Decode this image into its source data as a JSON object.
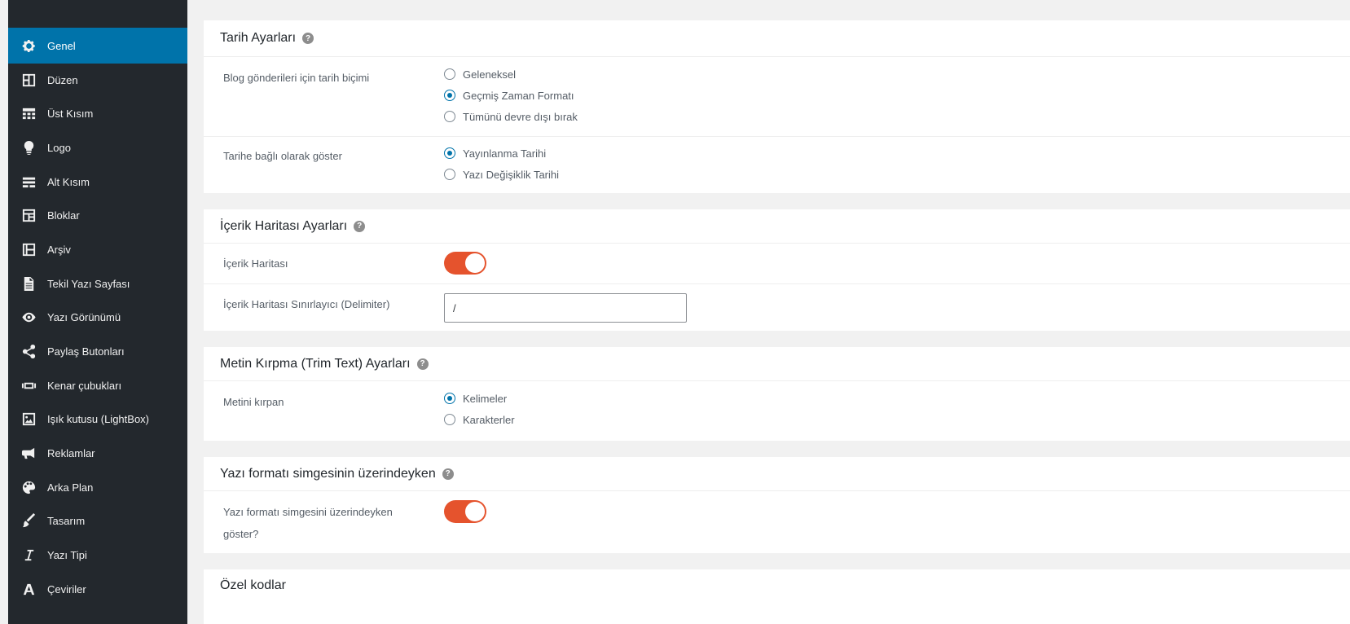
{
  "sidebar": {
    "items": [
      {
        "label": "Genel",
        "icon": "gear-icon",
        "active": true
      },
      {
        "label": "Düzen",
        "icon": "layout-icon"
      },
      {
        "label": "Üst Kısım",
        "icon": "header-grid-icon"
      },
      {
        "label": "Logo",
        "icon": "lightbulb-icon"
      },
      {
        "label": "Alt Kısım",
        "icon": "footer-icon"
      },
      {
        "label": "Bloklar",
        "icon": "blocks-icon"
      },
      {
        "label": "Arşiv",
        "icon": "archive-icon"
      },
      {
        "label": "Tekil Yazı Sayfası",
        "icon": "document-icon"
      },
      {
        "label": "Yazı Görünümü",
        "icon": "eye-icon"
      },
      {
        "label": "Paylaş Butonları",
        "icon": "share-icon"
      },
      {
        "label": "Kenar çubukları",
        "icon": "sidebar-icon"
      },
      {
        "label": "Işık kutusu (LightBox)",
        "icon": "image-icon"
      },
      {
        "label": "Reklamlar",
        "icon": "megaphone-icon"
      },
      {
        "label": "Arka Plan",
        "icon": "palette-icon"
      },
      {
        "label": "Tasarım",
        "icon": "brush-icon"
      },
      {
        "label": "Yazı Tipi",
        "icon": "italic-icon"
      },
      {
        "label": "Çeviriler",
        "icon": "translate-icon"
      }
    ]
  },
  "sections": {
    "date": {
      "title": "Tarih Ayarları",
      "format_label": "Blog gönderileri için tarih biçimi",
      "format_options": [
        "Geleneksel",
        "Geçmiş Zaman Formatı",
        "Tümünü devre dışı bırak"
      ],
      "format_selected": "Geçmiş Zaman Formatı",
      "show_label": "Tarihe bağlı olarak göster",
      "show_options": [
        "Yayınlanma Tarihi",
        "Yazı Değişiklik Tarihi"
      ],
      "show_selected": "Yayınlanma Tarihi"
    },
    "breadcrumb": {
      "title": "İçerik Haritası Ayarları",
      "enable_label": "İçerik Haritası",
      "enable_value": true,
      "delimiter_label": "İçerik Haritası Sınırlayıcı (Delimiter)",
      "delimiter_value": "/"
    },
    "trim": {
      "title": "Metin Kırpma (Trim Text) Ayarları",
      "trim_label": "Metini kırpan",
      "trim_options": [
        "Kelimeler",
        "Karakterler"
      ],
      "trim_selected": "Kelimeler"
    },
    "format_icon": {
      "title": "Yazı formatı simgesinin üzerindeyken",
      "show_label": "Yazı formatı simgesini üzerindeyken göster?",
      "show_value": true
    },
    "custom_codes": {
      "title": "Özel kodlar"
    }
  },
  "help_glyph": "?",
  "colors": {
    "sidebar_bg": "#23282d",
    "active": "#0073aa",
    "toggle_on": "#e5532d"
  }
}
